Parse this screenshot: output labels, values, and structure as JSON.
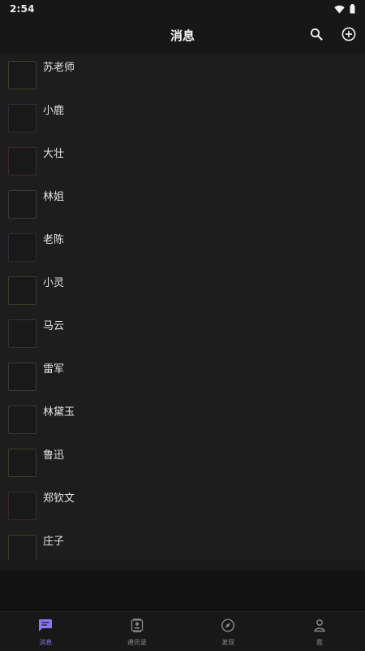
{
  "status_bar": {
    "time": "2:54",
    "icons": [
      "wifi-icon",
      "battery-icon"
    ]
  },
  "header": {
    "title": "消息",
    "actions": [
      "search-icon",
      "add-circle-icon"
    ]
  },
  "chats": [
    {
      "name": "苏老师",
      "avatar_color": "#3b3f2a"
    },
    {
      "name": "小鹿",
      "avatar_color": "#2d2d3b"
    },
    {
      "name": "大壮",
      "avatar_color": "#3b2a2d"
    },
    {
      "name": "林姐",
      "avatar_color": "#3a3a3a"
    },
    {
      "name": "老陈",
      "avatar_color": "#2a2d3b"
    },
    {
      "name": "小灵",
      "avatar_color": "#3b3d2a"
    },
    {
      "name": "马云",
      "avatar_color": "#333333"
    },
    {
      "name": "雷军",
      "avatar_color": "#3a3a3a"
    },
    {
      "name": "林黛玉",
      "avatar_color": "#363636"
    },
    {
      "name": "鲁迅",
      "avatar_color": "#3b3d2a"
    },
    {
      "name": "郑钦文",
      "avatar_color": "#3b2a30"
    },
    {
      "name": "庄子",
      "avatar_color": "#3b3d2a"
    }
  ],
  "bottom_nav": {
    "tabs": [
      {
        "label": "消息",
        "icon": "chat-bubble-icon",
        "active": true
      },
      {
        "label": "通讯录",
        "icon": "contacts-icon",
        "active": false
      },
      {
        "label": "发现",
        "icon": "compass-icon",
        "active": false
      },
      {
        "label": "我",
        "icon": "person-icon",
        "active": false
      }
    ]
  },
  "colors": {
    "accent": "#8e73f2",
    "background": "#1d1d1d",
    "header": "#171717"
  }
}
